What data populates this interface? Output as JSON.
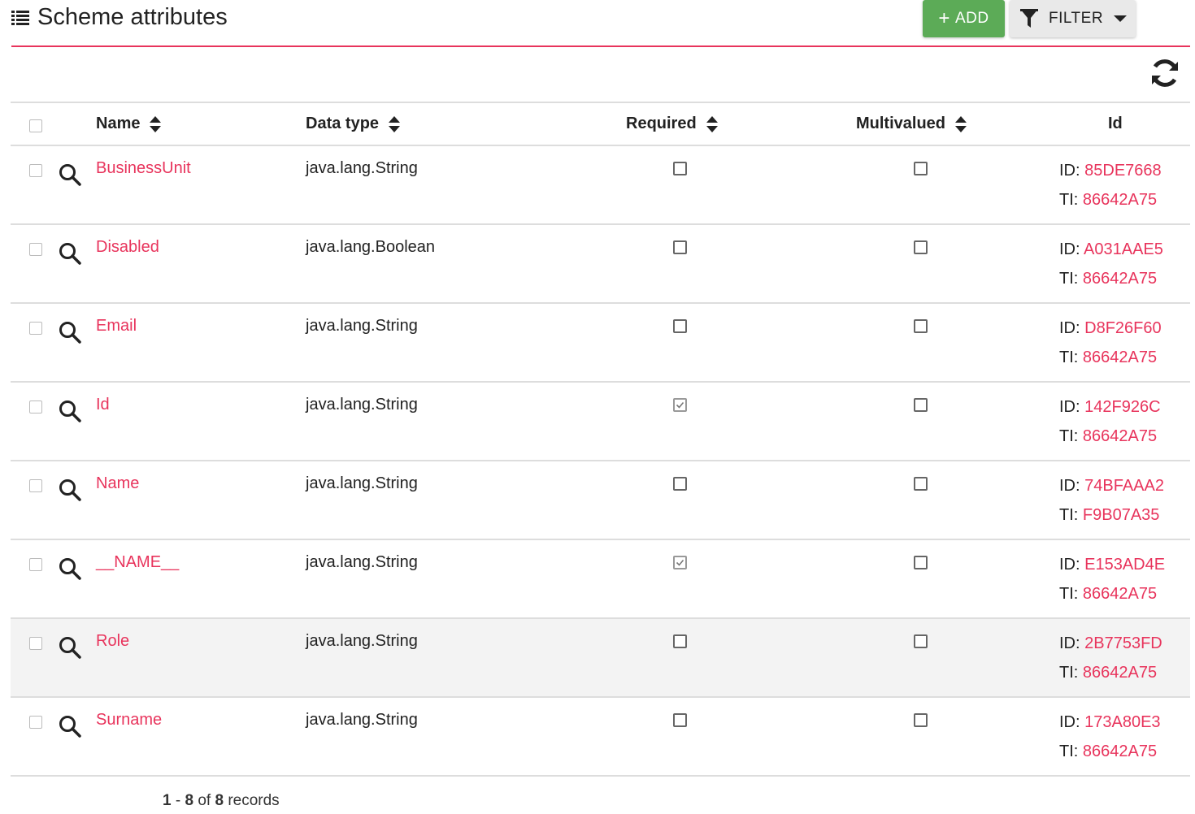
{
  "header": {
    "title": "Scheme attributes"
  },
  "toolbar": {
    "add_label": "ADD",
    "filter_label": "FILTER"
  },
  "columns": {
    "name": "Name",
    "data_type": "Data type",
    "required": "Required",
    "multivalued": "Multivalued",
    "id": "Id"
  },
  "rows": [
    {
      "name": "BusinessUnit",
      "data_type": "java.lang.String",
      "required": false,
      "multivalued": false,
      "id_label": "ID:",
      "id": "85DE7668",
      "ti_label": "TI:",
      "ti": "86642A75"
    },
    {
      "name": "Disabled",
      "data_type": "java.lang.Boolean",
      "required": false,
      "multivalued": false,
      "id_label": "ID:",
      "id": "A031AAE5",
      "ti_label": "TI:",
      "ti": "86642A75"
    },
    {
      "name": "Email",
      "data_type": "java.lang.String",
      "required": false,
      "multivalued": false,
      "id_label": "ID:",
      "id": "D8F26F60",
      "ti_label": "TI:",
      "ti": "86642A75"
    },
    {
      "name": "Id",
      "data_type": "java.lang.String",
      "required": true,
      "multivalued": false,
      "id_label": "ID:",
      "id": "142F926C",
      "ti_label": "TI:",
      "ti": "86642A75"
    },
    {
      "name": "Name",
      "data_type": "java.lang.String",
      "required": false,
      "multivalued": false,
      "id_label": "ID:",
      "id": "74BFAAA2",
      "ti_label": "TI:",
      "ti": "F9B07A35"
    },
    {
      "name": "__NAME__",
      "data_type": "java.lang.String",
      "required": true,
      "multivalued": false,
      "id_label": "ID:",
      "id": "E153AD4E",
      "ti_label": "TI:",
      "ti": "86642A75"
    },
    {
      "name": "Role",
      "data_type": "java.lang.String",
      "required": false,
      "multivalued": false,
      "id_label": "ID:",
      "id": "2B7753FD",
      "ti_label": "TI:",
      "ti": "86642A75"
    },
    {
      "name": "Surname",
      "data_type": "java.lang.String",
      "required": false,
      "multivalued": false,
      "id_label": "ID:",
      "id": "173A80E3",
      "ti_label": "TI:",
      "ti": "86642A75"
    }
  ],
  "footer": {
    "from": "1",
    "sep": "-",
    "to": "8",
    "of": "of",
    "total": "8",
    "records": "records"
  },
  "colors": {
    "accent": "#e8345c",
    "add_button": "#5cab57",
    "filter_button": "#e9e9e9"
  },
  "icons": {
    "title": "list-icon",
    "add": "plus-icon",
    "filter": "funnel-icon",
    "refresh": "refresh-icon",
    "row_view": "search-icon",
    "sort": "sort-icon"
  }
}
